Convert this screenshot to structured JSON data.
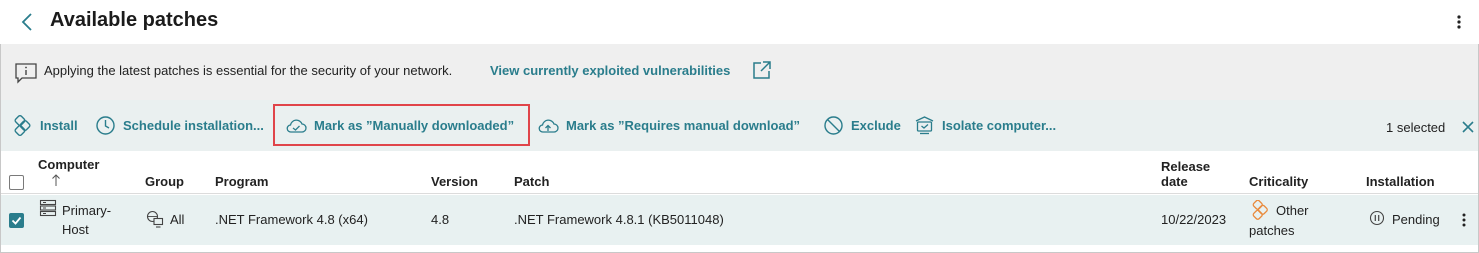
{
  "header": {
    "title": "Available patches"
  },
  "info": {
    "message": "Applying the latest patches is essential for the security of your network.",
    "link": "View currently exploited vulnerabilities"
  },
  "toolbar": {
    "install": "Install",
    "schedule": "Schedule installation...",
    "mark_manual": "Mark as ”Manually downloaded”",
    "mark_requires": "Mark as ”Requires manual download”",
    "exclude": "Exclude",
    "isolate": "Isolate computer...",
    "selected": "1 selected"
  },
  "table": {
    "columns": {
      "computer": "Computer",
      "group": "Group",
      "program": "Program",
      "version": "Version",
      "patch": "Patch",
      "release_line1": "Release",
      "release_line2": "date",
      "criticality": "Criticality",
      "installation": "Installation"
    },
    "sort": "ascending",
    "rows": [
      {
        "selected": true,
        "computer_line1": "Primary-",
        "computer_line2": "Host",
        "group": "All",
        "program": ".NET Framework 4.8 (x64)",
        "version": "4.8",
        "patch": ".NET Framework 4.8.1 (KB5011048)",
        "release_date": "10/22/2023",
        "criticality_line1": "Other",
        "criticality_line2": "patches",
        "installation": "Pending"
      }
    ]
  },
  "colors": {
    "accent": "#2a7d8c",
    "highlight": "#e0454a",
    "criticality_icon": "#e98a3c"
  }
}
